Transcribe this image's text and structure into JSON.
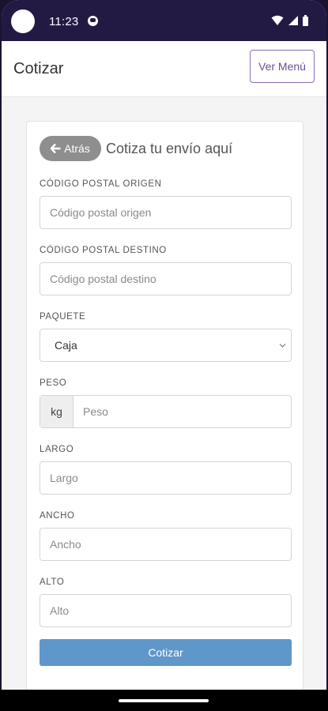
{
  "status_bar": {
    "time": "11:23"
  },
  "app_bar": {
    "title": "Cotizar",
    "menu_button": "Ver Menú"
  },
  "card": {
    "back_button": "Atrás",
    "heading": "Cotiza tu envío aquí"
  },
  "form": {
    "origin": {
      "label": "CÓDIGO POSTAL ORIGEN",
      "placeholder": "Código postal origen"
    },
    "destination": {
      "label": "CÓDIGO POSTAL DESTINO",
      "placeholder": "Código postal destino"
    },
    "package": {
      "label": "PAQUETE",
      "value": "Caja"
    },
    "weight": {
      "label": "PESO",
      "unit": "kg",
      "placeholder": "Peso"
    },
    "length": {
      "label": "LARGO",
      "placeholder": "Largo"
    },
    "width": {
      "label": "ANCHO",
      "placeholder": "Ancho"
    },
    "height": {
      "label": "ALTO",
      "placeholder": "Alto"
    },
    "submit_label": "Cotizar"
  },
  "colors": {
    "status_bar": "#231a44",
    "primary_button": "#5f97ca",
    "back_button": "#8e8e8e",
    "menu_button_accent": "#6b4f99"
  },
  "icons": [
    "camera-cutout-icon",
    "notification-icon",
    "wifi-icon",
    "signal-icon",
    "battery-icon",
    "arrow-left-icon",
    "chevron-down-icon"
  ]
}
